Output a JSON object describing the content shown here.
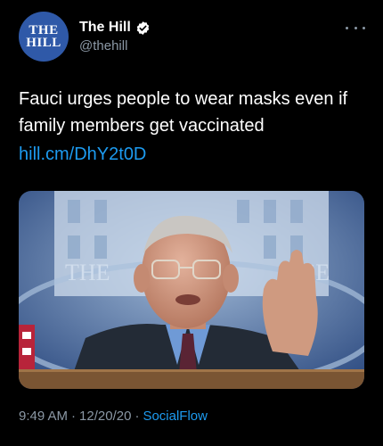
{
  "account": {
    "avatar_text_line1": "THE",
    "avatar_text_line2": "HILL",
    "display_name": "The Hill",
    "handle": "@thehill",
    "verified": true
  },
  "tweet": {
    "text": "Fauci urges people to wear masks even if family members get vaccinated",
    "link": "hill.cm/DhY2t0D",
    "media_sign_left": "THE",
    "media_sign_right": "USE",
    "time": "9:49 AM",
    "separator": "·",
    "date": "12/20/20",
    "source": "SocialFlow"
  },
  "colors": {
    "background": "#000000",
    "text": "#ffffff",
    "secondary_text": "#8b98a5",
    "link": "#1d9bf0",
    "avatar_bg": "#2f59a8"
  },
  "icons": {
    "verified": "verified-badge-icon",
    "more": "more-horizontal-icon"
  }
}
